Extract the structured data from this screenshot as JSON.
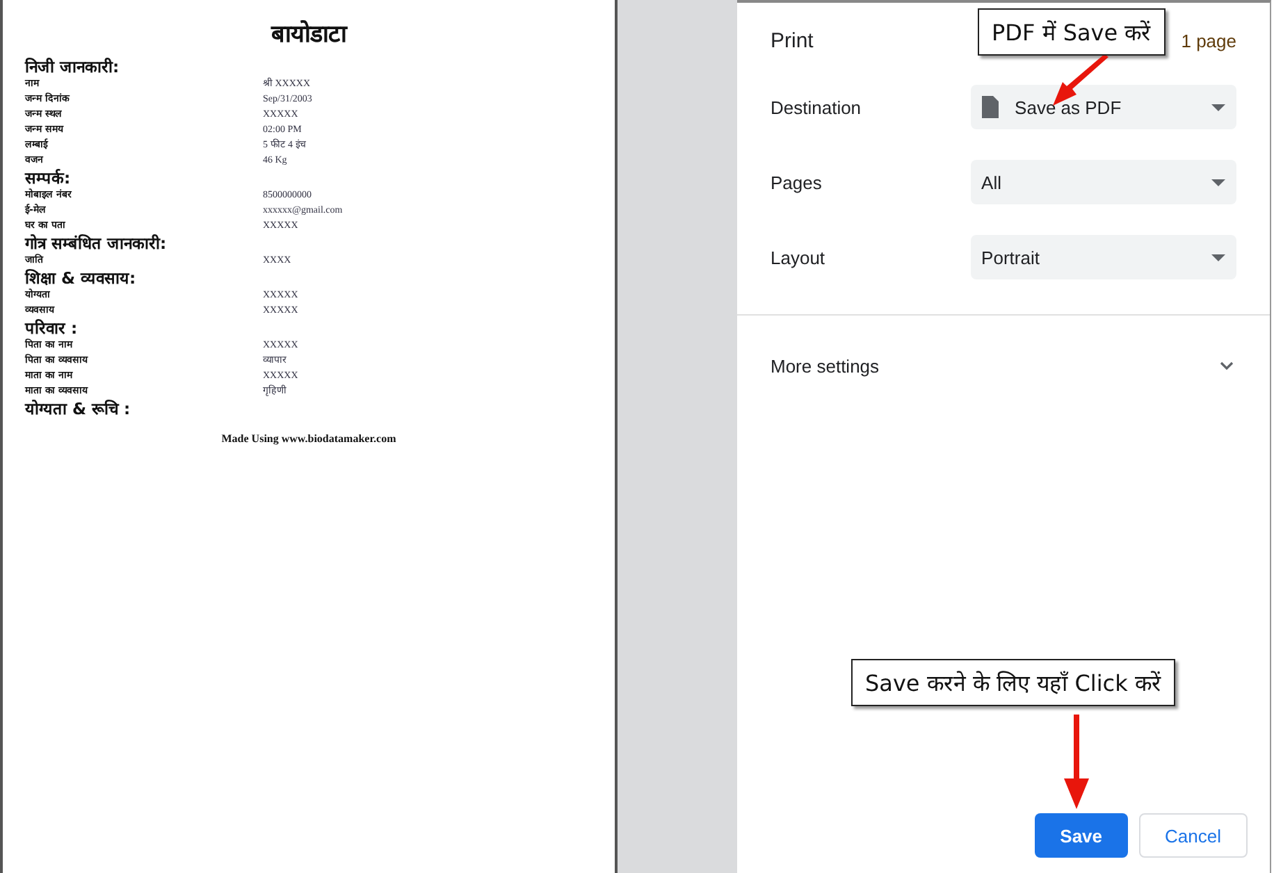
{
  "preview": {
    "title": "बायोडाटा",
    "sections": [
      {
        "heading": "निजी जानकारी:",
        "rows": [
          {
            "label": "नाम",
            "value": "श्री XXXXX"
          },
          {
            "label": "जन्म दिनांक",
            "value": "Sep/31/2003"
          },
          {
            "label": "जन्म स्थल",
            "value": "XXXXX"
          },
          {
            "label": "जन्म समय",
            "value": "02:00 PM"
          },
          {
            "label": "लम्बाई",
            "value": "5 फीट 4 इंच"
          },
          {
            "label": "वजन",
            "value": "46 Kg"
          }
        ]
      },
      {
        "heading": "सम्पर्क:",
        "rows": [
          {
            "label": "मोबाइल नंबर",
            "value": "8500000000"
          },
          {
            "label": "ई-मेल",
            "value": "xxxxxx@gmail.com"
          },
          {
            "label": "घर का पता",
            "value": "XXXXX"
          }
        ]
      },
      {
        "heading": "गोत्र सम्बंधित जानकारी:",
        "rows": [
          {
            "label": "जाति",
            "value": "XXXX"
          }
        ]
      },
      {
        "heading": "शिक्षा & व्यवसाय:",
        "rows": [
          {
            "label": "योग्यता",
            "value": "XXXXX"
          },
          {
            "label": "व्यवसाय",
            "value": "XXXXX"
          }
        ]
      },
      {
        "heading": "परिवार :",
        "rows": [
          {
            "label": "पिता का नाम",
            "value": "XXXXX"
          },
          {
            "label": "पिता का व्यवसाय",
            "value": "व्यापार"
          },
          {
            "label": "माता का नाम",
            "value": "XXXXX"
          },
          {
            "label": "माता का व्यवसाय",
            "value": "गृहिणी"
          }
        ]
      },
      {
        "heading": "योग्यता & रूचि :"
      }
    ],
    "footer": "Made Using www.biodatamaker.com"
  },
  "print_panel": {
    "title": "Print",
    "page_count": "1 page",
    "settings": [
      {
        "label": "Destination",
        "value": "Save as PDF",
        "kind": "destination"
      },
      {
        "label": "Pages",
        "value": "All",
        "kind": "plain"
      },
      {
        "label": "Layout",
        "value": "Portrait",
        "kind": "plain"
      }
    ],
    "more_settings": {
      "label": "More settings",
      "expanded": false
    },
    "buttons": [
      {
        "label": "Save",
        "kind": "primary"
      },
      {
        "label": "Cancel",
        "kind": "secondary"
      }
    ]
  },
  "callouts": [
    {
      "text": "PDF में Save करें",
      "kind": "top"
    },
    {
      "text": "Save करने के लिए यहाँ Click करें",
      "kind": "bottom"
    }
  ]
}
